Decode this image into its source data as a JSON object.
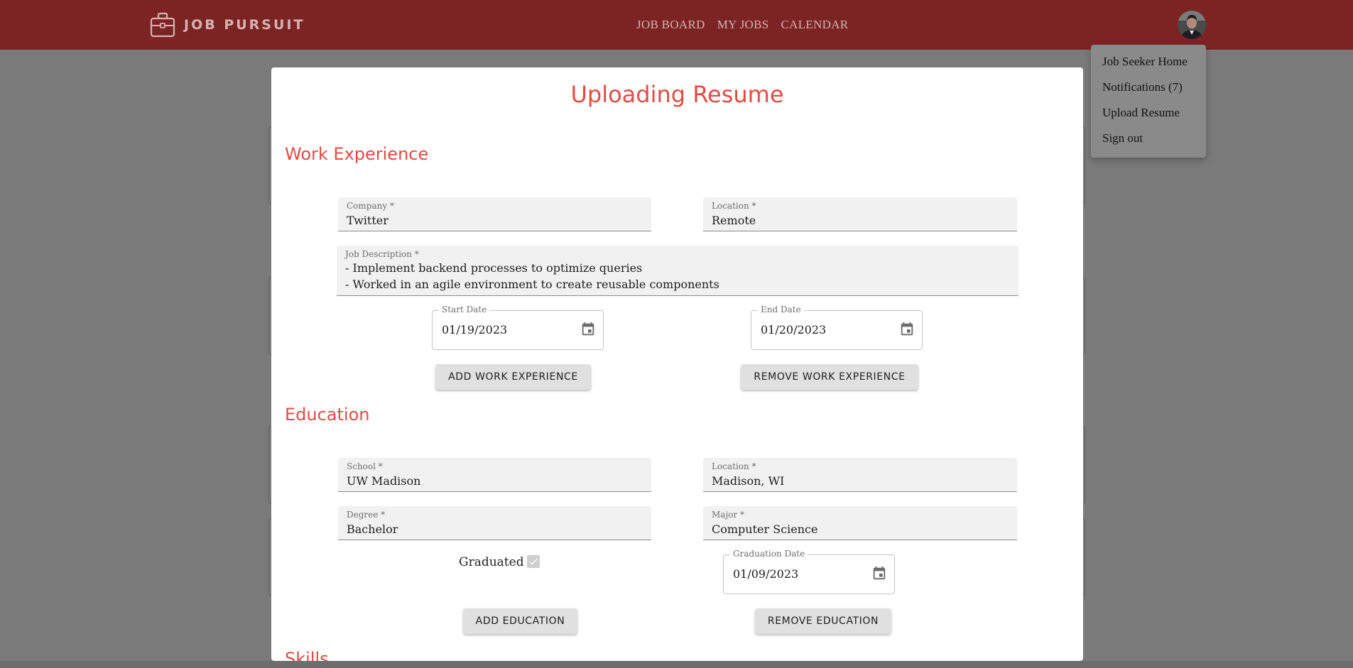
{
  "header": {
    "logo_text": "JOB PURSUIT",
    "logo_icon": "briefcase-icon",
    "nav": [
      {
        "label": "JOB BOARD"
      },
      {
        "label": "MY JOBS"
      },
      {
        "label": "CALENDAR"
      }
    ],
    "avatar": "user-avatar",
    "bar_color": "#7c2424"
  },
  "account_menu": {
    "items": [
      {
        "label": "Job Seeker Home"
      },
      {
        "label": "Notifications (7)"
      },
      {
        "label": "Upload Resume"
      },
      {
        "label": "Sign out"
      }
    ]
  },
  "modal": {
    "title": "Uploading Resume",
    "accent_color": "#e34b44",
    "work": {
      "section_title": "Work Experience",
      "company_label": "Company *",
      "company": "Twitter",
      "location_label": "Location *",
      "location": "Remote",
      "description_label": "Job Description *",
      "description": "- Implement backend processes to optimize queries\n- Worked in an agile environment to create reusable components",
      "start_label": "Start Date",
      "start_date": "01/19/2023",
      "end_label": "End Date",
      "end_date": "01/20/2023",
      "add_button": "ADD WORK EXPERIENCE",
      "remove_button": "REMOVE WORK EXPERIENCE"
    },
    "education": {
      "section_title": "Education",
      "school_label": "School *",
      "school": "UW Madison",
      "location_label": "Location *",
      "location": "Madison, WI",
      "degree_label": "Degree *",
      "degree": "Bachelor",
      "major_label": "Major *",
      "major": "Computer Science",
      "graduated_label": "Graduated",
      "graduated": true,
      "graduation_label": "Graduation Date",
      "graduation_date": "01/09/2023",
      "add_button": "ADD EDUCATION",
      "remove_button": "REMOVE EDUCATION"
    },
    "skills": {
      "section_title": "Skills"
    }
  }
}
